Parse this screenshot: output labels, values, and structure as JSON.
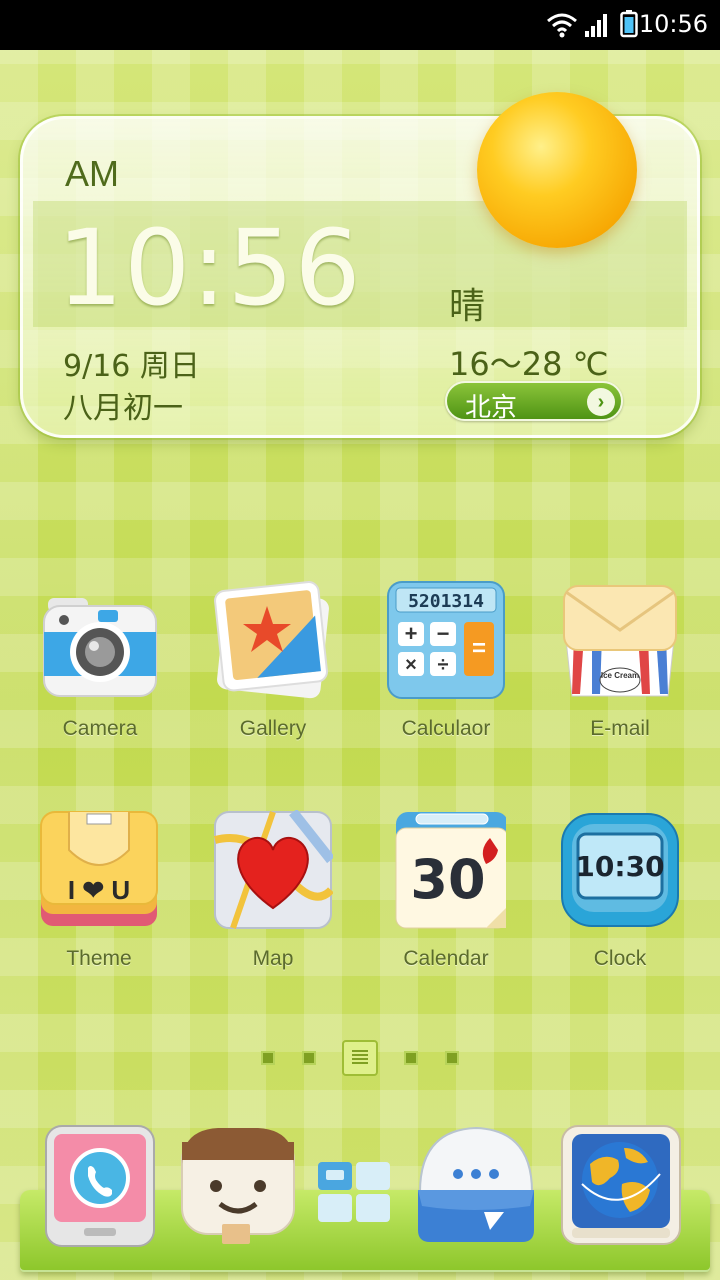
{
  "status_bar": {
    "time": "10:56",
    "icons": [
      "wifi-icon",
      "signal-icon",
      "battery-icon"
    ]
  },
  "weather_widget": {
    "ampm": "AM",
    "time": "10:56",
    "date": "9/16 周日",
    "lunar_date": "八月初一",
    "condition": "晴",
    "temperature": "16～28 ℃",
    "city": "北京",
    "weather_icon": "sun-icon"
  },
  "apps": [
    {
      "label": "Camera",
      "icon": "camera-icon"
    },
    {
      "label": "Gallery",
      "icon": "gallery-icon"
    },
    {
      "label": "Calculaor",
      "icon": "calculator-icon",
      "display": "5201314"
    },
    {
      "label": "E-mail",
      "icon": "email-icon",
      "sticker": "Ice Cream"
    },
    {
      "label": "Theme",
      "icon": "theme-icon",
      "text": "I ❤ U"
    },
    {
      "label": "Map",
      "icon": "map-icon"
    },
    {
      "label": "Calendar",
      "icon": "calendar-icon",
      "day": "30"
    },
    {
      "label": "Clock",
      "icon": "clock-icon",
      "display": "10:30"
    }
  ],
  "page_indicator": {
    "count": 5,
    "active_index": 2
  },
  "dock": [
    {
      "icon": "phone-icon"
    },
    {
      "icon": "contacts-icon"
    },
    {
      "icon": "app-drawer-icon"
    },
    {
      "icon": "messaging-icon"
    },
    {
      "icon": "browser-icon"
    }
  ],
  "colors": {
    "wallpaper": "#cde06a",
    "accent_green": "#4f9414",
    "text_dark_green": "#4b6218",
    "sun_orange": "#f6a400"
  }
}
